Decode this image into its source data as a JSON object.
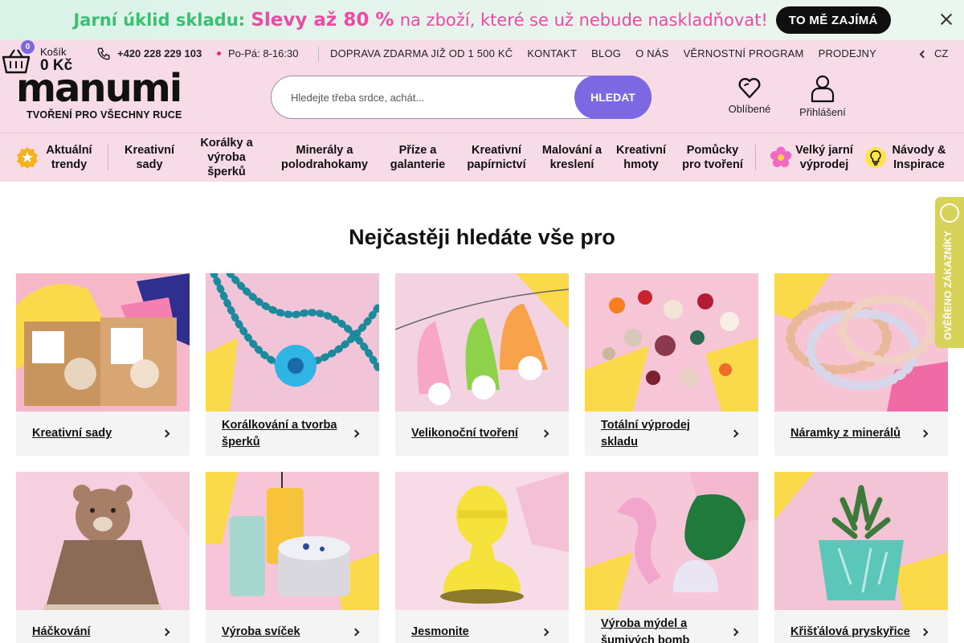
{
  "promo": {
    "lead": "Jarní úklid skladu:",
    "accent": "Slevy až 80 %",
    "rest": "na zboží, které se už nebude naskladňovat!",
    "button": "TO MĚ ZAJÍMÁ"
  },
  "topbar": {
    "phone": "+420 228 229 103",
    "hours": "Po-Pá: 8-16:30",
    "links": [
      "DOPRAVA ZDARMA JIŽ OD 1 500 KČ",
      "KONTAKT",
      "BLOG",
      "O NÁS",
      "VĚRNOSTNÍ PROGRAM",
      "PRODEJNY"
    ],
    "lang": "CZ"
  },
  "logo": {
    "word": "manumi",
    "tagline": "TVOŘENÍ PRO VŠECHNY RUCE"
  },
  "search": {
    "placeholder": "Hledejte třeba srdce, achát...",
    "button": "HLEDAT"
  },
  "header_icons": {
    "favorites": "Oblíbené",
    "login": "Přihlášení",
    "cart_label": "Košík",
    "cart_total": "0 Kč",
    "cart_count": "0"
  },
  "nav": [
    {
      "label": "Aktuální trendy"
    },
    {
      "label": "Kreativní sady"
    },
    {
      "label": "Korálky a výroba šperků"
    },
    {
      "label": "Minerály a polodrahokamy"
    },
    {
      "label": "Příze a galanterie"
    },
    {
      "label": "Kreativní papírnictví"
    },
    {
      "label": "Malování a kreslení"
    },
    {
      "label": "Kreativní hmoty"
    },
    {
      "label": "Pomůcky pro tvoření"
    },
    {
      "label": "Velký jarní výprodej"
    },
    {
      "label": "Návody & Inspirace"
    }
  ],
  "main": {
    "title": "Nejčastěji hledáte vše pro",
    "cards": [
      {
        "label": "Kreativní sady"
      },
      {
        "label": "Korálkování a tvorba šperků"
      },
      {
        "label": "Velikonoční tvoření"
      },
      {
        "label": "Totální výprodej skladu"
      },
      {
        "label": "Náramky z minerálů"
      },
      {
        "label": "Háčkování"
      },
      {
        "label": "Výroba svíček"
      },
      {
        "label": "Jesmonite"
      },
      {
        "label": "Výroba mýdel a šumivých bomb"
      },
      {
        "label": "Křišťálová pryskyřice"
      }
    ]
  },
  "side_badge": {
    "text": "OVĚŘENO ZÁKAZNÍKY"
  },
  "colors": {
    "accent": "#7b68e2",
    "header_bg": "#f7dbe7",
    "promo_pink": "#ec4aa3",
    "promo_green": "#3cbf73"
  }
}
